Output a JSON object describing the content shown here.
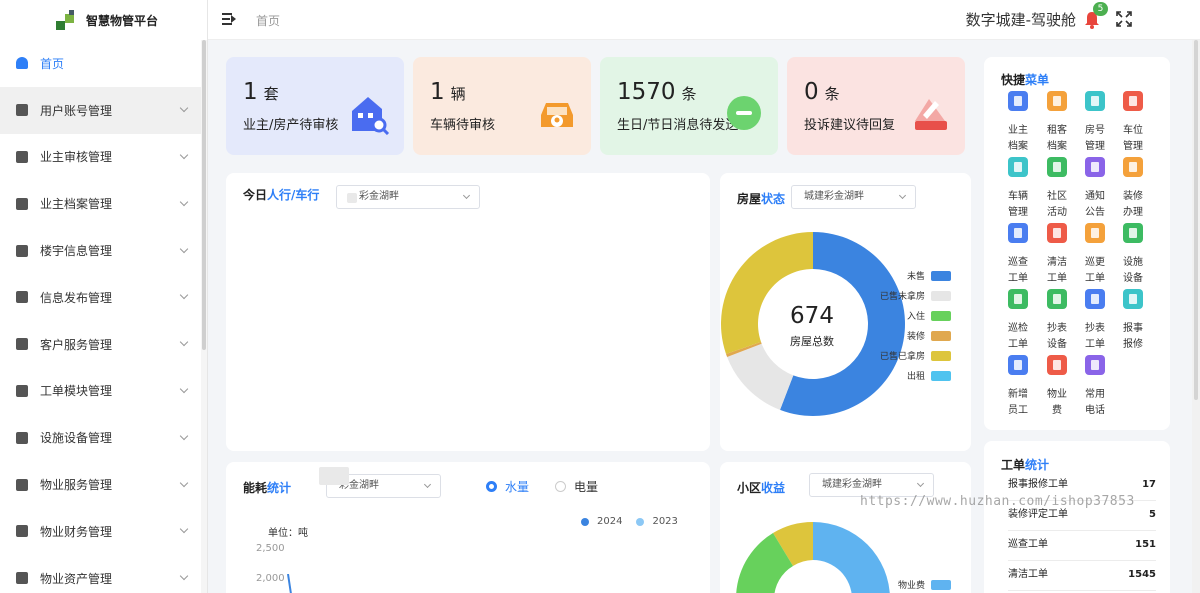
{
  "app": {
    "title": "智慧物管平台"
  },
  "header": {
    "breadcrumb": "首页",
    "title": "数字城建-驾驶舱",
    "notification_count": "5"
  },
  "sidebar": {
    "items": [
      {
        "label": "首页",
        "icon": "dashboard-icon"
      },
      {
        "label": "用户账号管理",
        "icon": "user-icon"
      },
      {
        "label": "业主审核管理",
        "icon": "audit-icon"
      },
      {
        "label": "业主档案管理",
        "icon": "file-icon"
      },
      {
        "label": "楼宇信息管理",
        "icon": "building-icon"
      },
      {
        "label": "信息发布管理",
        "icon": "publish-icon"
      },
      {
        "label": "客户服务管理",
        "icon": "folder-icon"
      },
      {
        "label": "工单模块管理",
        "icon": "workorder-icon"
      },
      {
        "label": "设施设备管理",
        "icon": "device-icon"
      },
      {
        "label": "物业服务管理",
        "icon": "service-icon"
      },
      {
        "label": "物业财务管理",
        "icon": "finance-icon"
      },
      {
        "label": "物业资产管理",
        "icon": "asset-icon"
      }
    ]
  },
  "stats": [
    {
      "value": "1",
      "unit": "套",
      "label": "业主/房产待审核",
      "icon": "house-search-icon",
      "bg": "#e4e9fb",
      "accent": "#4a6cf0"
    },
    {
      "value": "1",
      "unit": "辆",
      "label": "车辆待审核",
      "icon": "car-icon",
      "bg": "#fbeadf",
      "accent": "#f39a2c"
    },
    {
      "value": "1570",
      "unit": "条",
      "label": "生日/节日消息待发送",
      "icon": "message-icon",
      "bg": "#e2f5e6",
      "accent": "#6cd36f"
    },
    {
      "value": "0",
      "unit": "条",
      "label": "投诉建议待回复",
      "icon": "complaint-icon",
      "bg": "#fbe3e1",
      "accent": "#e8504a"
    }
  ],
  "traffic": {
    "title_a": "今日",
    "title_b": "人行/车行",
    "select": "彩金湖畔"
  },
  "house": {
    "title_a": "房屋",
    "title_b": "状态",
    "select": "城建彩金湖畔",
    "center_value": "674",
    "center_label": "房屋总数",
    "legend": [
      {
        "name": "未售",
        "color": "#3b84e0"
      },
      {
        "name": "已售未拿房",
        "color": "#e6e6e6"
      },
      {
        "name": "入住",
        "color": "#67d15c"
      },
      {
        "name": "装修",
        "color": "#e0a84f"
      },
      {
        "name": "已售已拿房",
        "color": "#ddc53c"
      },
      {
        "name": "出租",
        "color": "#4fc3ef"
      }
    ]
  },
  "energy": {
    "title_a": "能耗",
    "title_b": "统计",
    "select": "彩金湖畔",
    "radio_water": "水量",
    "radio_power": "电量",
    "legend_2024": "2024",
    "legend_2023": "2023",
    "color_2024": "#3b84e0",
    "color_2023": "#8cc8f5",
    "unit": "单位：吨",
    "ticks": [
      "2,500",
      "2,000"
    ]
  },
  "income": {
    "title_a": "小区",
    "title_b": "收益",
    "select": "城建彩金湖畔",
    "legend_first": "物业费"
  },
  "quick": {
    "title_a": "快捷",
    "title_b": "菜单",
    "items": [
      {
        "label": "业主\n档案",
        "color": "#4a7df0"
      },
      {
        "label": "租客\n档案",
        "color": "#f4a13b"
      },
      {
        "label": "房号\n管理",
        "color": "#3cc4c9"
      },
      {
        "label": "车位\n管理",
        "color": "#ee5b48"
      },
      {
        "label": "车辆\n管理",
        "color": "#3cc4c9"
      },
      {
        "label": "社区\n活动",
        "color": "#3dbb62"
      },
      {
        "label": "通知\n公告",
        "color": "#8a64e8"
      },
      {
        "label": "装修\n办理",
        "color": "#f4a13b"
      },
      {
        "label": "巡查\n工单",
        "color": "#4a7df0"
      },
      {
        "label": "清洁\n工单",
        "color": "#ee5b48"
      },
      {
        "label": "巡更\n工单",
        "color": "#f4a13b"
      },
      {
        "label": "设施\n设备",
        "color": "#3dbb62"
      },
      {
        "label": "巡检\n工单",
        "color": "#3dbb62"
      },
      {
        "label": "抄表\n设备",
        "color": "#3dbb62"
      },
      {
        "label": "抄表\n工单",
        "color": "#4a7df0"
      },
      {
        "label": "报事\n报修",
        "color": "#3cc4c9"
      },
      {
        "label": "新增\n员工",
        "color": "#4a7df0"
      },
      {
        "label": "物业\n费",
        "color": "#ee5b48"
      },
      {
        "label": "常用\n电话",
        "color": "#8a64e8"
      }
    ]
  },
  "workorders": {
    "title_a": "工单",
    "title_b": "统计",
    "rows": [
      {
        "name": "报事报修工单",
        "value": "17"
      },
      {
        "name": "装修评定工单",
        "value": "5"
      },
      {
        "name": "巡查工单",
        "value": "151"
      },
      {
        "name": "清洁工单",
        "value": "1545"
      }
    ]
  },
  "watermark": "https://www.huzhan.com/ishop37853"
}
